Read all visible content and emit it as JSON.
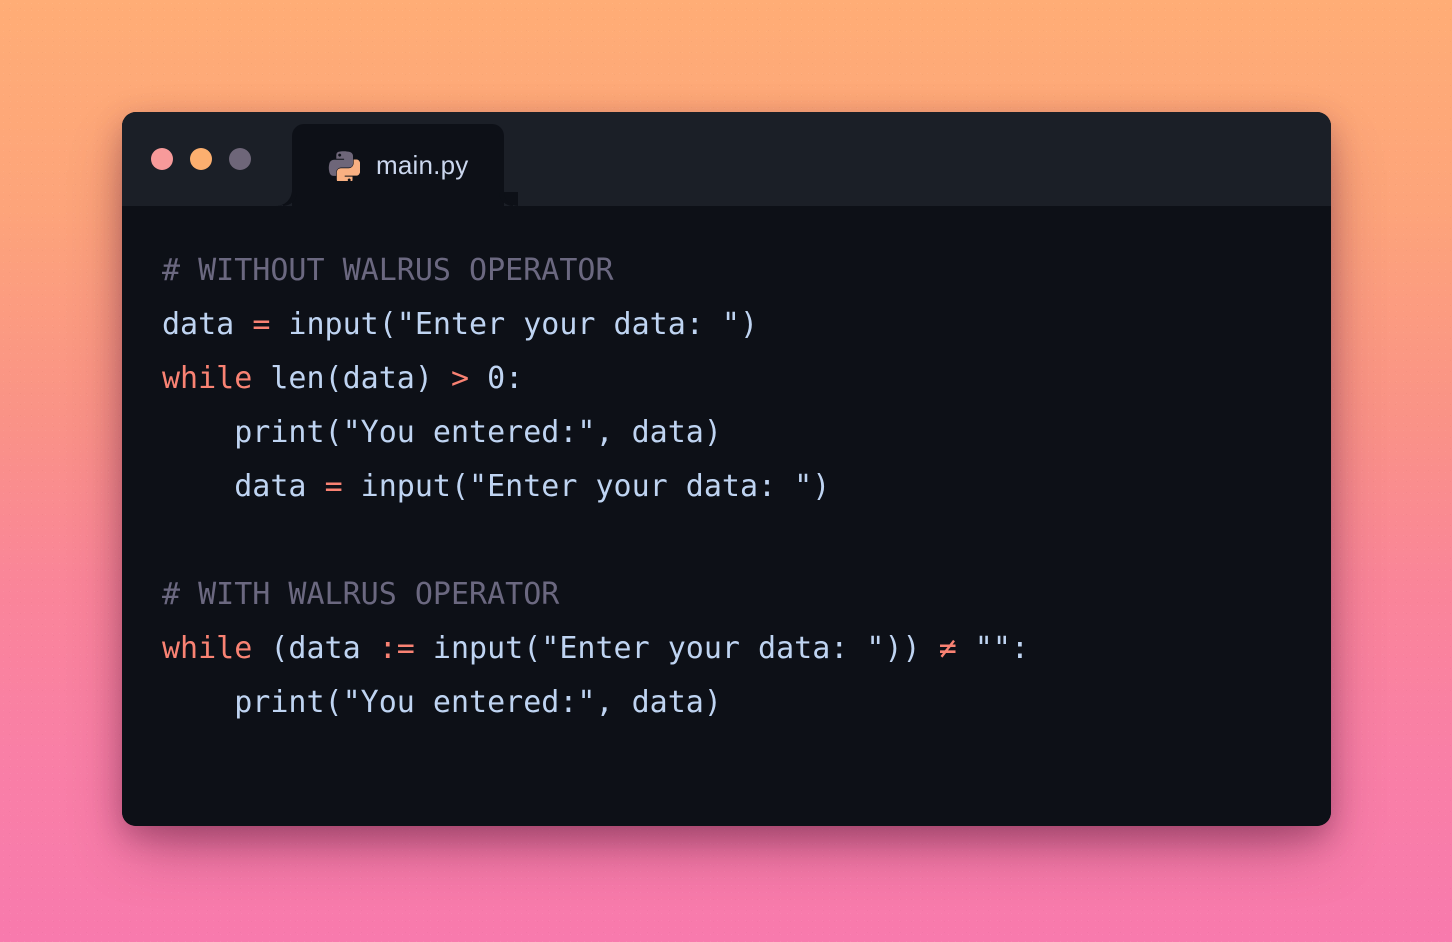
{
  "background": {
    "gradient_from": "#FFAD76",
    "gradient_mid": "#FA9287",
    "gradient_to": "#F87AAD",
    "direction": "vertical"
  },
  "window": {
    "body_bg": "#0D1017",
    "titlebar_bg": "#1B1F27",
    "traffic_lights": [
      {
        "name": "close",
        "color": "#F79A9A"
      },
      {
        "name": "minimize",
        "color": "#FCAF6F"
      },
      {
        "name": "maximize",
        "color": "#6E6679"
      }
    ],
    "tab": {
      "label": "main.py",
      "icon": "python-icon",
      "icon_colors": {
        "top": "#6E6679",
        "bottom": "#F8B082"
      },
      "active": true
    }
  },
  "editor": {
    "language": "python",
    "theme_colors": {
      "text": "#BFD4F2",
      "comment": "#6B6880",
      "keyword": "#F98273",
      "operator": "#F98273"
    },
    "lines": [
      {
        "n": 1,
        "text": "# WITHOUT WALRUS OPERATOR",
        "tokens": [
          {
            "t": "# WITHOUT WALRUS OPERATOR",
            "c": "comment"
          }
        ]
      },
      {
        "n": 2,
        "text": "data = input(\"Enter your data: \")",
        "tokens": [
          {
            "t": "data ",
            "c": "plain"
          },
          {
            "t": "=",
            "c": "operator"
          },
          {
            "t": " input(\"Enter your data: \")",
            "c": "plain"
          }
        ]
      },
      {
        "n": 3,
        "text": "while len(data) > 0:",
        "tokens": [
          {
            "t": "while",
            "c": "keyword"
          },
          {
            "t": " len(data) ",
            "c": "plain"
          },
          {
            "t": ">",
            "c": "operator"
          },
          {
            "t": " 0:",
            "c": "plain"
          }
        ]
      },
      {
        "n": 4,
        "text": "    print(\"You entered:\", data)",
        "tokens": [
          {
            "t": "    print(\"You entered:\", data)",
            "c": "plain"
          }
        ]
      },
      {
        "n": 5,
        "text": "    data = input(\"Enter your data: \")",
        "tokens": [
          {
            "t": "    data ",
            "c": "plain"
          },
          {
            "t": "=",
            "c": "operator"
          },
          {
            "t": " input(\"Enter your data: \")",
            "c": "plain"
          }
        ]
      },
      {
        "n": 6,
        "text": "",
        "tokens": []
      },
      {
        "n": 7,
        "text": "# WITH WALRUS OPERATOR",
        "tokens": [
          {
            "t": "# WITH WALRUS OPERATOR",
            "c": "comment"
          }
        ]
      },
      {
        "n": 8,
        "text": "while (data := input(\"Enter your data: \")) != \"\":",
        "tokens": [
          {
            "t": "while",
            "c": "keyword"
          },
          {
            "t": " (data ",
            "c": "plain"
          },
          {
            "t": ":=",
            "c": "operator"
          },
          {
            "t": " input(\"Enter your data: \")) ",
            "c": "plain"
          },
          {
            "t": "≠",
            "c": "operator"
          },
          {
            "t": " \"\":",
            "c": "plain"
          }
        ]
      },
      {
        "n": 9,
        "text": "    print(\"You entered:\", data)",
        "tokens": [
          {
            "t": "    print(\"You entered:\", data)",
            "c": "plain"
          }
        ]
      }
    ]
  }
}
